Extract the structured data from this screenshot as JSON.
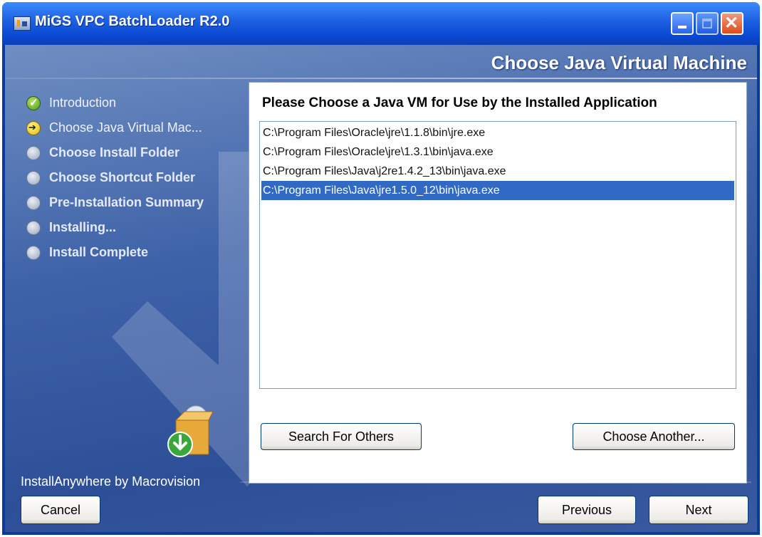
{
  "window": {
    "title": "MiGS VPC BatchLoader R2.0",
    "controls": {
      "minimize_icon": "minimize-icon",
      "maximize_icon": "maximize-icon",
      "close_icon": "close-icon"
    }
  },
  "header": {
    "title": "Choose Java Virtual Machine"
  },
  "steps": [
    {
      "label": "Introduction",
      "status": "done",
      "icon": "check-icon"
    },
    {
      "label": "Choose Java Virtual Mac...",
      "status": "current",
      "icon": "arrow-right-icon"
    },
    {
      "label": "Choose Install Folder",
      "status": "pending",
      "icon": "bullet-icon"
    },
    {
      "label": "Choose Shortcut Folder",
      "status": "pending",
      "icon": "bullet-icon"
    },
    {
      "label": "Pre-Installation Summary",
      "status": "pending",
      "icon": "bullet-icon"
    },
    {
      "label": "Installing...",
      "status": "pending",
      "icon": "bullet-icon"
    },
    {
      "label": "Install Complete",
      "status": "pending",
      "icon": "bullet-icon"
    }
  ],
  "panel": {
    "title": "Please Choose a Java VM for Use by the Installed Application",
    "vm_options": [
      "C:\\Program Files\\Oracle\\jre\\1.1.8\\bin\\jre.exe",
      "C:\\Program Files\\Oracle\\jre\\1.3.1\\bin\\java.exe",
      "C:\\Program Files\\Java\\j2re1.4.2_13\\bin\\java.exe",
      "C:\\Program Files\\Java\\jre1.5.0_12\\bin\\java.exe"
    ],
    "selected_index": 3,
    "search_button": "Search For Others",
    "choose_button": "Choose Another..."
  },
  "footer": {
    "brand": "InstallAnywhere by Macrovision",
    "cancel": "Cancel",
    "previous": "Previous",
    "next": "Next"
  },
  "colors": {
    "titlebar": "#0a48d2",
    "background": "#3e62a8",
    "selection": "#316ac5"
  }
}
